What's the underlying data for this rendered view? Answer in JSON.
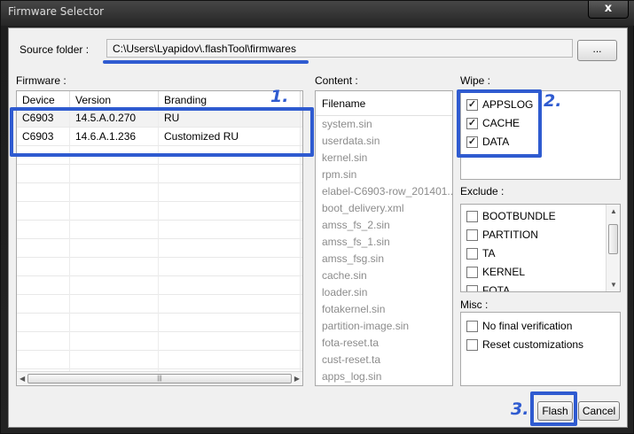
{
  "window": {
    "title": "Firmware Selector",
    "close_label": "x"
  },
  "source": {
    "label": "Source folder :",
    "path": "C:\\Users\\Lyapidov\\.flashTool\\firmwares",
    "browse_label": "..."
  },
  "firmware": {
    "label": "Firmware :",
    "columns": [
      "Device",
      "Version",
      "Branding"
    ],
    "rows": [
      {
        "device": "C6903",
        "version": "14.5.A.0.270",
        "branding": "RU"
      },
      {
        "device": "C6903",
        "version": "14.6.A.1.236",
        "branding": "Customized RU"
      }
    ]
  },
  "content": {
    "label": "Content :",
    "header": "Filename",
    "files": [
      "system.sin",
      "userdata.sin",
      "kernel.sin",
      "rpm.sin",
      "elabel-C6903-row_201401...",
      "boot_delivery.xml",
      "amss_fs_2.sin",
      "amss_fs_1.sin",
      "amss_fsg.sin",
      "cache.sin",
      "loader.sin",
      "fotakernel.sin",
      "partition-image.sin",
      "fota-reset.ta",
      "cust-reset.ta",
      "apps_log.sin"
    ]
  },
  "wipe": {
    "label": "Wipe :",
    "items": [
      {
        "label": "APPSLOG",
        "checked": true
      },
      {
        "label": "CACHE",
        "checked": true
      },
      {
        "label": "DATA",
        "checked": true
      }
    ]
  },
  "exclude": {
    "label": "Exclude :",
    "items": [
      {
        "label": "BOOTBUNDLE",
        "checked": false
      },
      {
        "label": "PARTITION",
        "checked": false
      },
      {
        "label": "TA",
        "checked": false
      },
      {
        "label": "KERNEL",
        "checked": false
      },
      {
        "label": "FOTA",
        "checked": false
      }
    ]
  },
  "misc": {
    "label": "Misc :",
    "items": [
      {
        "label": "No final verification",
        "checked": false
      },
      {
        "label": "Reset customizations",
        "checked": false
      }
    ]
  },
  "buttons": {
    "flash": "Flash",
    "cancel": "Cancel"
  },
  "annotations": {
    "one": "1.",
    "two": "2.",
    "three": "3.",
    "color": "#2f5bd0"
  }
}
